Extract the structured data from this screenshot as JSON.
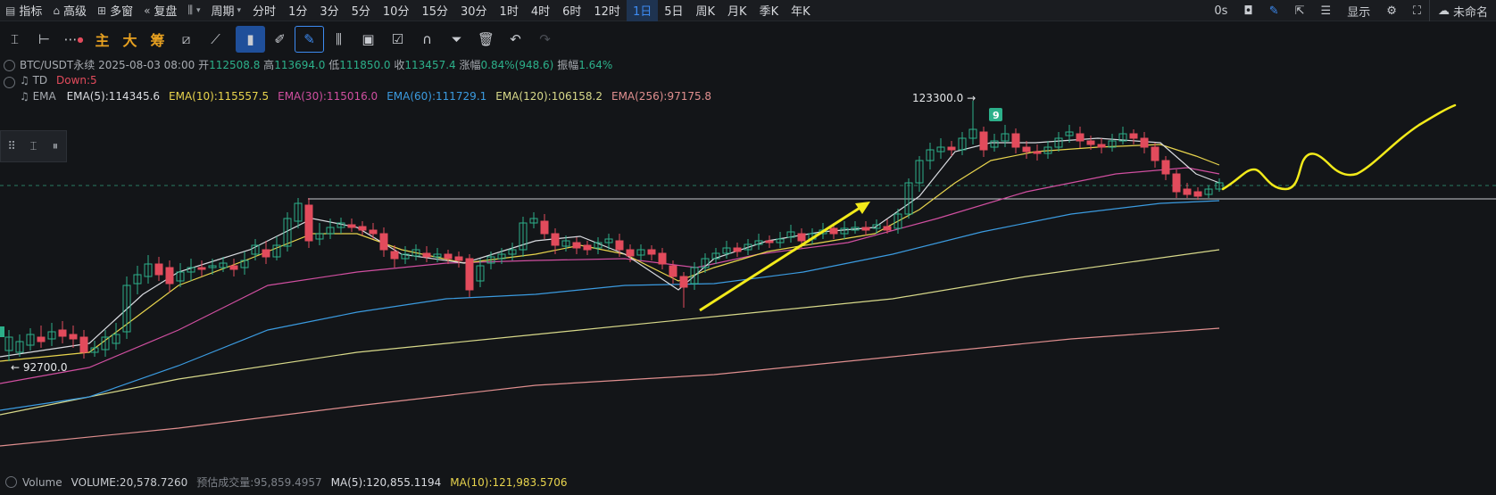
{
  "toolbar": {
    "indicator": "指标",
    "advanced": "高级",
    "multi_window": "多窗",
    "replay": "复盘",
    "period": "周期",
    "intervals": [
      "分时",
      "1分",
      "3分",
      "5分",
      "10分",
      "15分",
      "30分",
      "1时",
      "4时",
      "6时",
      "12时",
      "1日",
      "5日",
      "周K",
      "月K",
      "季K",
      "年K"
    ],
    "active_interval": "1日",
    "countdown": "0s",
    "display": "显示",
    "unnamed": "未命名"
  },
  "drawbar": {
    "main": "主",
    "big": "大",
    "chips": "筹"
  },
  "info": {
    "symbol": "BTC/USDT永续",
    "datetime": "2025-08-03 08:00",
    "open_label": "开",
    "open": "112508.8",
    "high_label": "高",
    "high": "113694.0",
    "low_label": "低",
    "low": "111850.0",
    "close_label": "收",
    "close": "113457.4",
    "change_label": "涨幅",
    "change": "0.84%(948.6)",
    "amplitude_label": "振幅",
    "amplitude": "1.64%",
    "td_label": "TD",
    "td_value": "Down:5",
    "ema_label": "EMA",
    "ema": [
      {
        "label": "EMA(5):114345.6",
        "color": "#d9dbe0"
      },
      {
        "label": "EMA(10):115557.5",
        "color": "#e8d44d"
      },
      {
        "label": "EMA(30):115016.0",
        "color": "#d04fa0"
      },
      {
        "label": "EMA(60):111729.1",
        "color": "#3b9be0"
      },
      {
        "label": "EMA(120):106158.2",
        "color": "#d8d98a"
      },
      {
        "label": "EMA(256):97175.8",
        "color": "#e08f8f"
      }
    ]
  },
  "annotations": {
    "high_marker": "123300.0 →",
    "low_marker": "← 92700.0",
    "td_count": "9"
  },
  "volume": {
    "label": "Volume",
    "volume": "VOLUME:20,578.7260",
    "estimated": "预估成交量:95,859.4957",
    "ma5": "MA(5):120,855.1194",
    "ma10": "MA(10):121,983.5706"
  },
  "colors": {
    "up": "#2cb08a",
    "down": "#e24b5c",
    "drawing": "#f2ea1a"
  }
}
